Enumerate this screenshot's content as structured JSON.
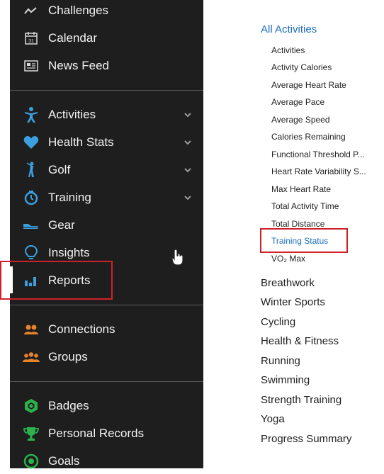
{
  "sidebar": {
    "items": [
      {
        "label": "Challenges",
        "icon": "challenges-icon"
      },
      {
        "label": "Calendar",
        "icon": "calendar-icon",
        "icon_text": "31"
      },
      {
        "label": "News Feed",
        "icon": "newsfeed-icon"
      },
      {
        "label": "Activities",
        "icon": "activities-icon",
        "expandable": true
      },
      {
        "label": "Health Stats",
        "icon": "heart-icon",
        "expandable": true
      },
      {
        "label": "Golf",
        "icon": "golf-icon",
        "expandable": true
      },
      {
        "label": "Training",
        "icon": "stopwatch-icon",
        "expandable": true
      },
      {
        "label": "Gear",
        "icon": "shoe-icon"
      },
      {
        "label": "Insights",
        "icon": "lightbulb-icon"
      },
      {
        "label": "Reports",
        "icon": "bar-chart-icon",
        "active": true
      },
      {
        "label": "Connections",
        "icon": "connections-icon"
      },
      {
        "label": "Groups",
        "icon": "groups-icon"
      },
      {
        "label": "Badges",
        "icon": "badge-icon"
      },
      {
        "label": "Personal Records",
        "icon": "trophy-icon"
      },
      {
        "label": "Goals",
        "icon": "goal-icon"
      }
    ]
  },
  "submenu": {
    "header": "All Activities",
    "items": [
      {
        "label": "Activities"
      },
      {
        "label": "Activity Calories"
      },
      {
        "label": "Average Heart Rate"
      },
      {
        "label": "Average Pace"
      },
      {
        "label": "Average Speed"
      },
      {
        "label": "Calories Remaining"
      },
      {
        "label": "Functional Threshold P..."
      },
      {
        "label": "Heart Rate Variability S..."
      },
      {
        "label": "Max Heart Rate"
      },
      {
        "label": "Total Activity Time"
      },
      {
        "label": "Total Distance"
      },
      {
        "label": "Training Status",
        "selected": true
      },
      {
        "label": "VO₂ Max"
      }
    ],
    "categories": [
      "Breathwork",
      "Winter Sports",
      "Cycling",
      "Health & Fitness",
      "Running",
      "Swimming",
      "Strength Training",
      "Yoga",
      "Progress Summary"
    ]
  },
  "colors": {
    "sidebar_bg": "#1e1e1e",
    "link_blue": "#1f6fbf",
    "icon_blue": "#3b9fe0",
    "icon_orange": "#e8832a",
    "icon_green": "#2bb24c",
    "highlight_red": "#d0202a"
  }
}
